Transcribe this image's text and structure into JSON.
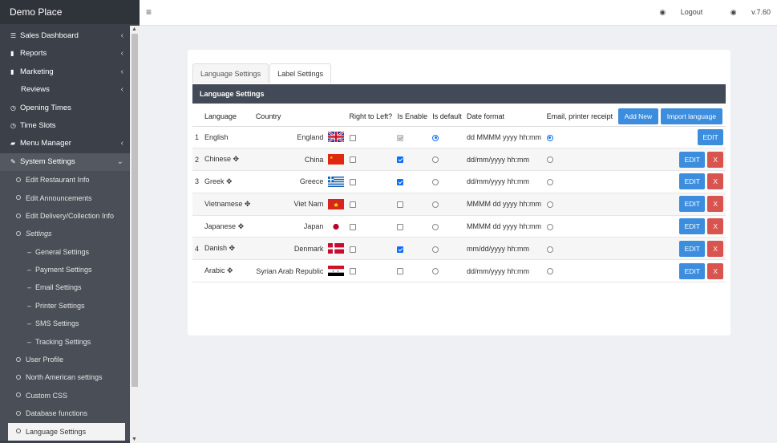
{
  "brand": "Demo Place",
  "topbar": {
    "menu_icon": "hamburger-icon",
    "logout": "Logout",
    "version": "v.7.60"
  },
  "sidebar": {
    "items": [
      {
        "icon": "list-icon",
        "label": "Sales Dashboard"
      },
      {
        "icon": "bar-chart-icon",
        "label": "Reports"
      },
      {
        "icon": "bar-chart-icon",
        "label": "Marketing"
      },
      {
        "icon": "",
        "label": "Reviews"
      },
      {
        "icon": "clock-icon",
        "label": "Opening Times"
      },
      {
        "icon": "clock-icon",
        "label": "Time Slots"
      },
      {
        "icon": "folder-icon",
        "label": "Menu Manager"
      },
      {
        "icon": "wrench-icon",
        "label": "System Settings"
      }
    ],
    "system_sub": [
      "Edit Restaurant Info",
      "Edit Announcements",
      "Edit Delivery/Collection Info",
      "Settings"
    ],
    "settings_sub": [
      "General Settings",
      "Payment Settings",
      "Email Settings",
      "Printer Settings",
      "SMS Settings",
      "Tracking Settings"
    ],
    "system_sub2": [
      "User Profile",
      "North American settings",
      "Custom CSS",
      "Database functions",
      "Language Settings"
    ]
  },
  "tabs": [
    "Language Settings",
    "Label Settings"
  ],
  "panel_title": "Language Settings",
  "table": {
    "headers": [
      "Language",
      "Country",
      "Right to Left?",
      "Is Enable",
      "Is default",
      "Date format",
      "Email, printer receipt"
    ],
    "add_new": "Add New",
    "import": "Import language",
    "edit": "EDIT",
    "delete": "X",
    "rows": [
      {
        "num": "1",
        "language": "English",
        "move": false,
        "country": "England",
        "flag": "uk",
        "rtl": false,
        "enabled": true,
        "enabled_disabled": true,
        "default": true,
        "date_format": "dd MMMM yyyy hh:mm",
        "email_default": true,
        "deletable": false
      },
      {
        "num": "2",
        "language": "Chinese",
        "move": true,
        "country": "China",
        "flag": "cn",
        "rtl": false,
        "enabled": true,
        "enabled_disabled": false,
        "default": false,
        "date_format": "dd/mm/yyyy hh:mm",
        "email_default": false,
        "deletable": true
      },
      {
        "num": "3",
        "language": "Greek",
        "move": true,
        "country": "Greece",
        "flag": "gr",
        "rtl": false,
        "enabled": true,
        "enabled_disabled": false,
        "default": false,
        "date_format": "dd/mm/yyyy hh:mm",
        "email_default": false,
        "deletable": true
      },
      {
        "num": "",
        "language": "Vietnamese",
        "move": true,
        "country": "Viet Nam",
        "flag": "vn",
        "rtl": false,
        "enabled": false,
        "enabled_disabled": false,
        "default": false,
        "date_format": "MMMM dd yyyy hh:mm",
        "email_default": false,
        "deletable": true
      },
      {
        "num": "",
        "language": "Japanese",
        "move": true,
        "country": "Japan",
        "flag": "jp",
        "rtl": false,
        "enabled": false,
        "enabled_disabled": false,
        "default": false,
        "date_format": "MMMM dd yyyy hh:mm",
        "email_default": false,
        "deletable": true
      },
      {
        "num": "4",
        "language": "Danish",
        "move": true,
        "country": "Denmark",
        "flag": "dk",
        "rtl": false,
        "enabled": true,
        "enabled_disabled": false,
        "default": false,
        "date_format": "mm/dd/yyyy hh:mm",
        "email_default": false,
        "deletable": true
      },
      {
        "num": "",
        "language": "Arabic",
        "move": true,
        "country": "Syrian Arab Republic",
        "flag": "sy",
        "rtl": false,
        "enabled": false,
        "enabled_disabled": false,
        "default": false,
        "date_format": "dd/mm/yyyy hh:mm",
        "email_default": false,
        "deletable": true
      }
    ]
  }
}
